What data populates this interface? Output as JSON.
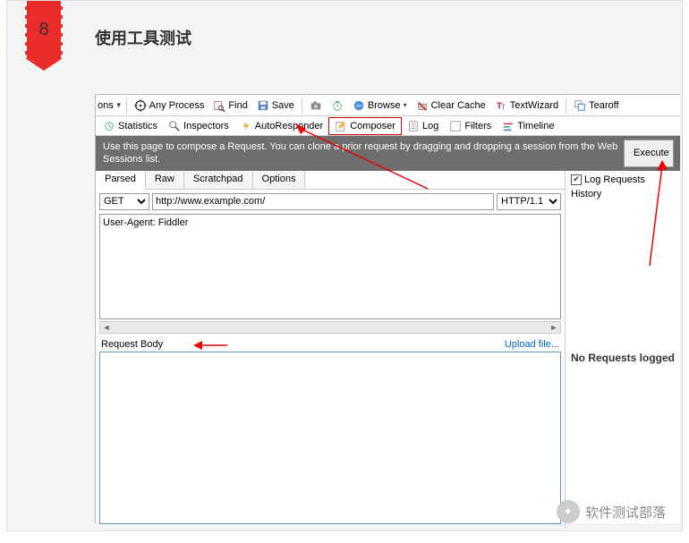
{
  "badge": {
    "number": "8"
  },
  "title": "使用工具测试",
  "toolbar1": {
    "prefix": "ons",
    "any_process": "Any Process",
    "find": "Find",
    "save": "Save",
    "browse": "Browse",
    "clear_cache": "Clear Cache",
    "textwizard": "TextWizard",
    "tearoff": "Tearoff"
  },
  "toolbar2": {
    "statistics": "Statistics",
    "inspectors": "Inspectors",
    "autoresponder": "AutoResponder",
    "composer": "Composer",
    "log": "Log",
    "filters": "Filters",
    "timeline": "Timeline"
  },
  "info_strip": "Use this page to compose a Request. You can clone a prior request by dragging and dropping a session from the Web Sessions list.",
  "execute_label": "Execute",
  "subtabs": {
    "parsed": "Parsed",
    "raw": "Raw",
    "scratchpad": "Scratchpad",
    "options": "Options"
  },
  "request": {
    "method": "GET",
    "url": "http://www.example.com/",
    "http_version": "HTTP/1.1",
    "headers": "User-Agent: Fiddler"
  },
  "body": {
    "label": "Request Body",
    "upload": "Upload file..."
  },
  "side": {
    "log_requests": "Log Requests",
    "history": "History",
    "no_requests": "No Requests logged"
  },
  "watermark": "软件测试部落"
}
